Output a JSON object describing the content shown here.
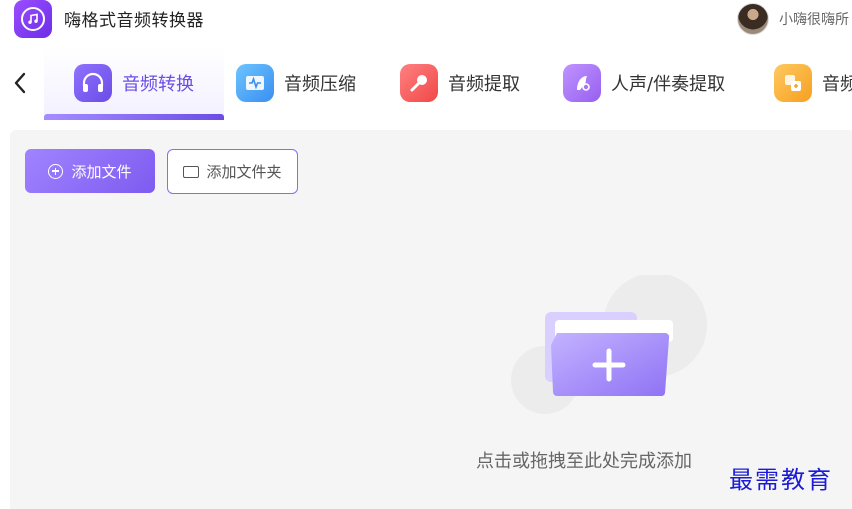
{
  "app": {
    "title": "嗨格式音频转换器"
  },
  "user": {
    "name": "小嗨很嗨所"
  },
  "tabs": [
    {
      "label": "音频转换",
      "icon": "headphones-icon",
      "color": "#6b4de6"
    },
    {
      "label": "音频压缩",
      "icon": "waveform-icon",
      "color": "#3aa3f0"
    },
    {
      "label": "音频提取",
      "icon": "microphone-icon",
      "color": "#f05050"
    },
    {
      "label": "人声/伴奏提取",
      "icon": "vocal-icon",
      "color": "#a46cf0"
    },
    {
      "label": "音频",
      "icon": "audio-merge-icon",
      "color": "#f5a623"
    }
  ],
  "toolbar": {
    "add_file_label": "添加文件",
    "add_folder_label": "添加文件夹"
  },
  "dropzone": {
    "hint": "点击或拖拽至此处完成添加"
  },
  "watermark": {
    "text": "最需教育"
  },
  "colors": {
    "accent": "#7e5bf0",
    "background": "#f5f5f5"
  }
}
